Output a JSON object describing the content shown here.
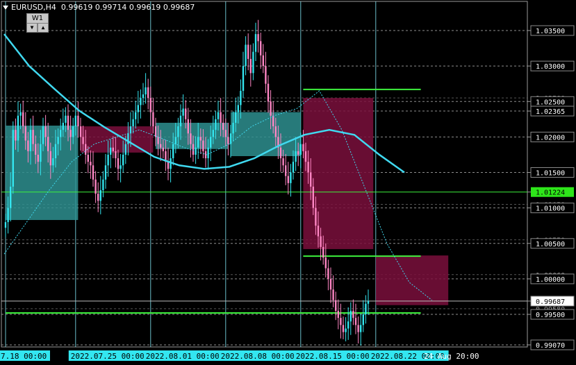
{
  "header": {
    "symbol": "EURUSD,H4",
    "ohlc": "0.99619 0.99714 0.99619 0.99687",
    "timeframe_label": "W1",
    "down_arrow": "▼",
    "up_arrow": "▲"
  },
  "colors": {
    "background": "#000000",
    "grid_v": "#7ee0ee",
    "grid_h": "#8f8f8f",
    "bull": "#33e6f0",
    "bear": "#ff86c4",
    "ma_slow": "#40d9f0",
    "zone_bull": "#2e8f8f",
    "zone_bear": "#7a0f3c",
    "level": "#3df23d",
    "price_box": "#2ee61a"
  },
  "chart_data": {
    "type": "candlestick",
    "symbol": "EURUSD",
    "timeframe": "H4",
    "y_ticks": [
      "1.03500",
      "1.03000",
      "1.02500",
      "1.02365",
      "1.02000",
      "1.01500",
      "1.01224",
      "1.01000",
      "1.00500",
      "1.00000",
      "0.99687",
      "0.99500",
      "0.99070"
    ],
    "y_tick_values": [
      1.035,
      1.03,
      1.025,
      1.02365,
      1.02,
      1.015,
      1.01224,
      1.01,
      1.005,
      1.0,
      0.99687,
      0.995,
      0.9907
    ],
    "hidden_labels": [
      {
        "text": "1.02500",
        "value": 1.0255
      },
      {
        "text": "1.01050",
        "value": 1.0105
      },
      {
        "text": "1.00550",
        "value": 1.0055
      },
      {
        "text": "1.00060",
        "value": 1.0006
      },
      {
        "text": "0.99580",
        "value": 0.9958
      }
    ],
    "current_price": "1.01224",
    "current_price_value": 1.01224,
    "bid_price": "0.99687",
    "bid_price_value": 0.99687,
    "x_ticks": [
      {
        "label": "7.18 00:00",
        "index": 0
      },
      {
        "label": "2022.07.25 00:00",
        "index": 28
      },
      {
        "label": "2022.08.01 00:00",
        "index": 58
      },
      {
        "label": "2022.08.08 00:00",
        "index": 88
      },
      {
        "label": "2022.08.15 00:00",
        "index": 118
      },
      {
        "label": "2022.08.22 00:00",
        "index": 148
      },
      {
        "label": "24 Aug 20:00",
        "index": 165
      }
    ],
    "x_fragments": [
      {
        "text": "2",
        "index": 14
      },
      {
        "text": "Aı",
        "index": 74
      },
      {
        "text": "2(",
        "index": 104
      },
      {
        "text": "20",
        "index": 134
      }
    ],
    "weekly_zones": [
      {
        "from": 0,
        "to": 29,
        "low": 1.0083,
        "high": 1.0216,
        "kind": "bull"
      },
      {
        "from": 30,
        "to": 59,
        "low": 1.0178,
        "high": 1.0215,
        "kind": "bear"
      },
      {
        "from": 60,
        "to": 89,
        "low": 1.0183,
        "high": 1.022,
        "kind": "bull"
      },
      {
        "from": 90,
        "to": 118,
        "low": 1.0173,
        "high": 1.0235,
        "kind": "bull"
      },
      {
        "from": 119,
        "to": 147,
        "low": 1.0042,
        "high": 1.0255,
        "kind": "bear"
      },
      {
        "from": 148,
        "to": 177,
        "low": 0.9963,
        "high": 1.0033,
        "kind": "bear"
      }
    ],
    "levels": [
      {
        "value": 1.0267,
        "from": 119,
        "to": 166
      },
      {
        "value": 1.0032,
        "from": 119,
        "to": 166
      },
      {
        "value": 0.9952,
        "from": 0,
        "to": 166
      }
    ],
    "ma_slow": [
      1.0345,
      1.03,
      1.0268,
      1.0237,
      1.0214,
      1.0193,
      1.0172,
      1.016,
      1.0155,
      1.0158,
      1.017,
      1.0188,
      1.0203,
      1.021,
      1.0203,
      1.0175,
      1.015
    ],
    "ma_fast": [
      1.0035,
      1.008,
      1.0125,
      1.0165,
      1.019,
      1.02,
      1.021,
      1.0198,
      1.0185,
      1.0175,
      1.019,
      1.0215,
      1.023,
      1.024,
      1.0265,
      1.021,
      1.013,
      1.005,
      0.9995,
      0.997
    ],
    "ma_step": 10,
    "ma_fast_step": 9,
    "closes": [
      1.008,
      1.01,
      1.013,
      1.021,
      1.0195,
      1.023,
      1.0235,
      1.0215,
      1.0195,
      1.018,
      1.021,
      1.019,
      1.0175,
      1.0165,
      1.019,
      1.0215,
      1.02,
      1.018,
      1.016,
      1.017,
      1.019,
      1.02,
      1.021,
      1.022,
      1.023,
      1.021,
      1.02,
      1.0215,
      1.023,
      1.0215,
      1.02,
      1.019,
      1.0175,
      1.0165,
      1.016,
      1.014,
      1.012,
      1.011,
      1.0125,
      1.014,
      1.016,
      1.0175,
      1.0185,
      1.018,
      1.017,
      1.0155,
      1.016,
      1.0175,
      1.019,
      1.0205,
      1.0215,
      1.0225,
      1.0235,
      1.0245,
      1.0255,
      1.026,
      1.027,
      1.0255,
      1.0235,
      1.0215,
      1.02,
      1.019,
      1.0185,
      1.018,
      1.0165,
      1.0155,
      1.017,
      1.019,
      1.02,
      1.0215,
      1.023,
      1.024,
      1.0225,
      1.0205,
      1.019,
      1.0175,
      1.0185,
      1.02,
      1.0195,
      1.018,
      1.017,
      1.0185,
      1.02,
      1.021,
      1.0225,
      1.0235,
      1.022,
      1.021,
      1.02,
      1.019,
      1.0205,
      1.022,
      1.0235,
      1.0245,
      1.0265,
      1.03,
      1.033,
      1.031,
      1.029,
      1.032,
      1.0345,
      1.0335,
      1.0315,
      1.03,
      1.0275,
      1.025,
      1.023,
      1.0215,
      1.02,
      1.0185,
      1.017,
      1.016,
      1.0145,
      1.0135,
      1.015,
      1.0165,
      1.018,
      1.0175,
      1.019,
      1.018,
      1.0165,
      1.015,
      1.013,
      1.01,
      1.0075,
      1.006,
      1.0045,
      1.003,
      1.0015,
      1.0,
      0.9985,
      0.997,
      0.9955,
      0.9945,
      0.9935,
      0.9925,
      0.993,
      0.994,
      0.9955,
      0.9945,
      0.9935,
      0.9925,
      0.9935,
      0.995,
      0.9965,
      0.9969
    ],
    "candle_spacing_px": 3.6
  }
}
